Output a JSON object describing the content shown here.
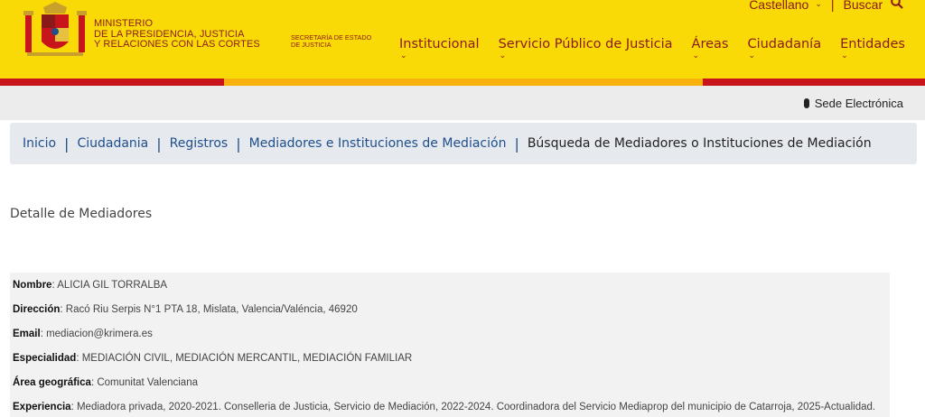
{
  "header": {
    "ministry_lines": [
      "MINISTERIO",
      "DE LA PRESIDENCIA, JUSTICIA",
      "Y RELACIONES CON LAS CORTES"
    ],
    "secretaria_lines": [
      "SECRETARÍA DE ESTADO",
      "DE JUSTICIA"
    ],
    "language": "Castellano",
    "search_label": "Buscar",
    "nav": [
      "Institucional",
      "Servicio Público de Justicia",
      "Áreas",
      "Ciudadanía",
      "Entidades"
    ],
    "colors": {
      "yellow": "#f9da06",
      "red": "#c8151b",
      "orange": "#f9b20d",
      "text": "#8a1a1a"
    }
  },
  "subbar": {
    "sede": "Sede Electrónica"
  },
  "breadcrumb": {
    "items": [
      "Inicio",
      "Ciudadania",
      "Registros",
      "Mediadores e Instituciones de Mediación"
    ],
    "current": "Búsqueda de Mediadores o Instituciones de Mediación"
  },
  "page_title": "Detalle de Mediadores",
  "details": {
    "nombre": {
      "label": "Nombre",
      "value": ": ALICIA GIL TORRALBA"
    },
    "direccion": {
      "label": "Dirección",
      "value": ": Racó Riu Serpis N°1 PTA 18, Mislata, Valencia/Valéncia, 46920"
    },
    "email": {
      "label": "Email",
      "value": ": mediacion@krimera.es"
    },
    "especialidad": {
      "label": "Especialidad",
      "value": ": MEDIACIÓN CIVIL, MEDIACIÓN MERCANTIL, MEDIACIÓN FAMILIAR"
    },
    "area": {
      "label": "Área geográfica",
      "value": ": Comunitat Valenciana"
    },
    "experiencia": {
      "label": "Experiencia",
      "value": ": Mediadora privada, 2020-2021. Conselleria de Justicia, Servicio de Mediación, 2022-2024. Coordinadora del Servicio Mediaprop del municipio de Catarroja, 2025-Actualidad."
    }
  }
}
